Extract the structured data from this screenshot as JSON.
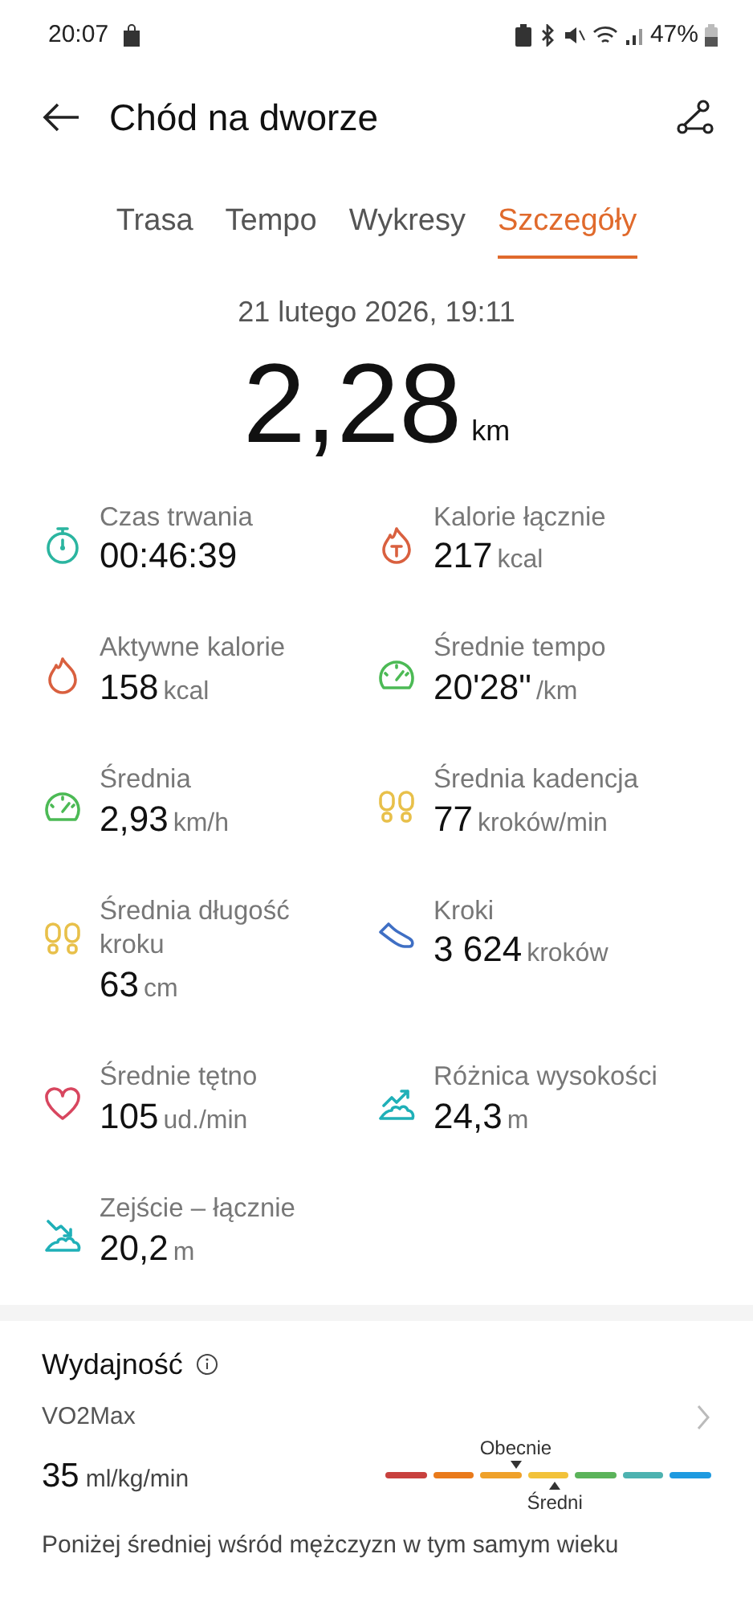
{
  "status_bar": {
    "time": "20:07",
    "battery": "47%"
  },
  "header": {
    "title": "Chód na dworze"
  },
  "tabs": [
    {
      "label": "Trasa",
      "selected": false
    },
    {
      "label": "Tempo",
      "selected": false
    },
    {
      "label": "Wykresy",
      "selected": false
    },
    {
      "label": "Szczegóły",
      "selected": true
    }
  ],
  "date": "21 lutego 2026, 19:11",
  "distance": {
    "value": "2,28",
    "unit": "km"
  },
  "metrics": [
    {
      "kind": "timer",
      "color": "#2bb5a0",
      "label": "Czas trwania",
      "value": "00:46:39"
    },
    {
      "kind": "calories-total",
      "color": "#d9603f",
      "label": "Kalorie łącznie",
      "value": "217",
      "unit": "kcal"
    },
    {
      "kind": "flame",
      "color": "#d9603f",
      "label": "Aktywne kalorie",
      "value": "158",
      "unit": "kcal"
    },
    {
      "kind": "gauge",
      "color": "#4cba55",
      "label": "Średnie tempo",
      "value": "20'28\"",
      "unit": "/km"
    },
    {
      "kind": "gauge",
      "color": "#4cba55",
      "label": "Średnia",
      "value": "2,93",
      "unit": "km/h"
    },
    {
      "kind": "footprints",
      "color": "#e8c04a",
      "label": "Średnia kadencja",
      "value": "77",
      "unit": "kroków/min"
    },
    {
      "kind": "footprints",
      "color": "#e8c04a",
      "label": "Średnia długość kroku",
      "value": "63",
      "unit": "cm"
    },
    {
      "kind": "shoe",
      "color": "#3f6fc4",
      "label": "Kroki",
      "value": "3 624",
      "unit": "kroków"
    },
    {
      "kind": "heart",
      "color": "#d8465f",
      "label": "Średnie tętno",
      "value": "105",
      "unit": "ud./min"
    },
    {
      "kind": "ascent",
      "color": "#1fb0b8",
      "label": "Różnica wysokości",
      "value": "24,3",
      "unit": "m"
    },
    {
      "kind": "descent",
      "color": "#1fb0b8",
      "label": "Zejście – łącznie",
      "value": "20,2",
      "unit": "m"
    }
  ],
  "performance": {
    "title": "Wydajność",
    "metric": "VO2Max",
    "value": "35",
    "unit": "ml/kg/min",
    "scale": [
      {
        "color": "#c8413e"
      },
      {
        "color": "#e97a1b"
      },
      {
        "color": "#efa12a"
      },
      {
        "color": "#f2c23a"
      },
      {
        "color": "#5bb35a"
      },
      {
        "color": "#4db2b0"
      },
      {
        "color": "#1e9ae0"
      }
    ],
    "current": {
      "label": "Obecnie",
      "level": 0.4
    },
    "average": {
      "label": "Średni",
      "level": 0.52
    },
    "summary": "Poniżej średniej wśród mężczyzn w tym samym wieku"
  }
}
